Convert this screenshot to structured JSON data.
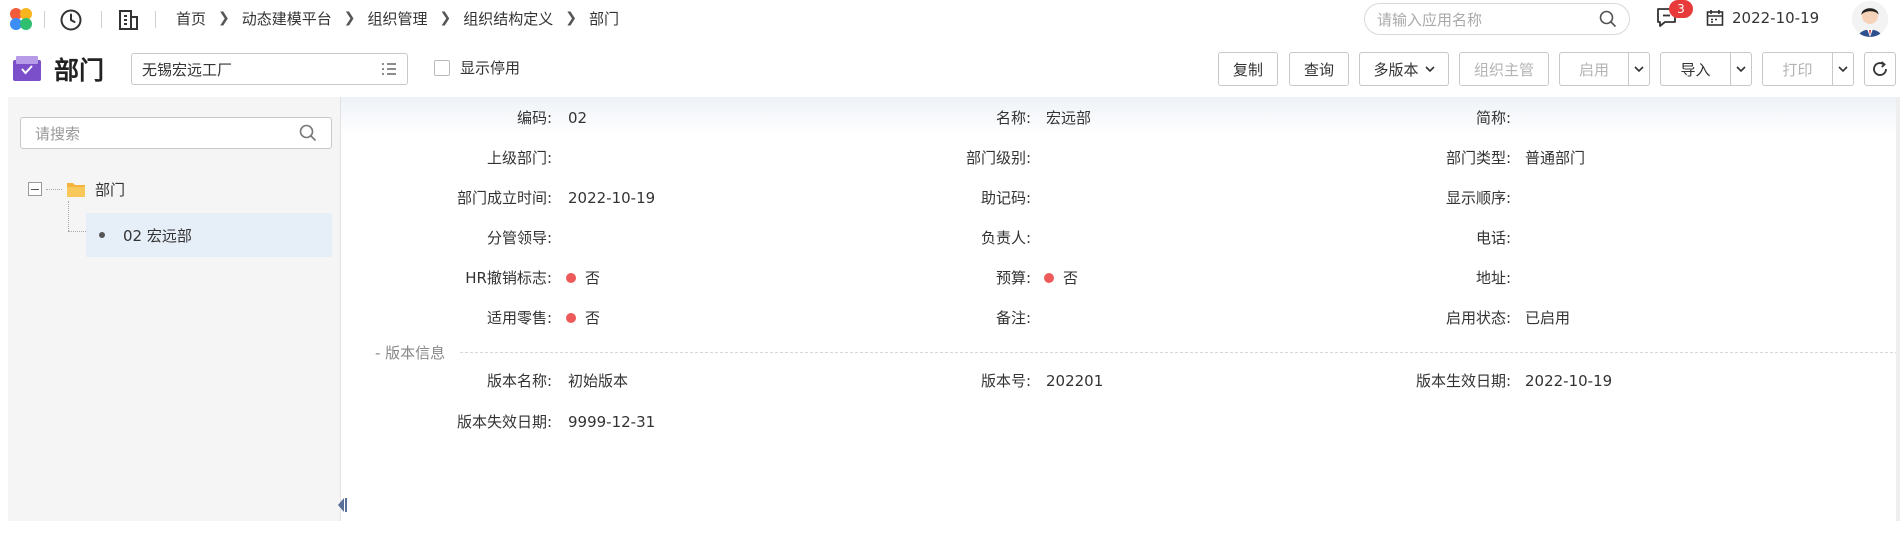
{
  "topbar": {
    "breadcrumbs": [
      "首页",
      "动态建模平台",
      "组织管理",
      "组织结构定义",
      "部门"
    ],
    "search_placeholder": "请输入应用名称",
    "message_badge": "3",
    "date": "2022-10-19"
  },
  "titlebar": {
    "title": "部门",
    "org_select_value": "无锡宏远工厂",
    "show_disabled_label": "显示停用",
    "buttons": {
      "copy": "复制",
      "query": "查询",
      "multi_version": "多版本",
      "org_manager": "组织主管",
      "enable": "启用",
      "import": "导入",
      "print": "打印"
    }
  },
  "tree": {
    "search_placeholder": "请搜索",
    "root_label": "部门",
    "child_label": "02 宏远部"
  },
  "details": {
    "rows": [
      {
        "l1": "编码:",
        "v1": "02",
        "l2": "名称:",
        "v2": "宏远部",
        "l3": "简称:",
        "v3": ""
      },
      {
        "l1": "上级部门:",
        "v1": "",
        "l2": "部门级别:",
        "v2": "",
        "l3": "部门类型:",
        "v3": "普通部门"
      },
      {
        "l1": "部门成立时间:",
        "v1": "2022-10-19",
        "l2": "助记码:",
        "v2": "",
        "l3": "显示顺序:",
        "v3": ""
      },
      {
        "l1": "分管领导:",
        "v1": "",
        "l2": "负责人:",
        "v2": "",
        "l3": "电话:",
        "v3": ""
      },
      {
        "l1": "HR撤销标志:",
        "v1": "否",
        "l2": "预算:",
        "v2": "否",
        "l3": "地址:",
        "v3": ""
      },
      {
        "l1": "适用零售:",
        "v1": "否",
        "l2": "备注:",
        "v2": "",
        "l3": "启用状态:",
        "v3": "已启用"
      }
    ],
    "version_section_title": "- 版本信息",
    "version_rows": [
      {
        "l1": "版本名称:",
        "v1": "初始版本",
        "l2": "版本号:",
        "v2": "202201",
        "l3": "版本生效日期:",
        "v3": "2022-10-19"
      },
      {
        "l1": "版本失效日期:",
        "v1": "9999-12-31"
      }
    ]
  }
}
